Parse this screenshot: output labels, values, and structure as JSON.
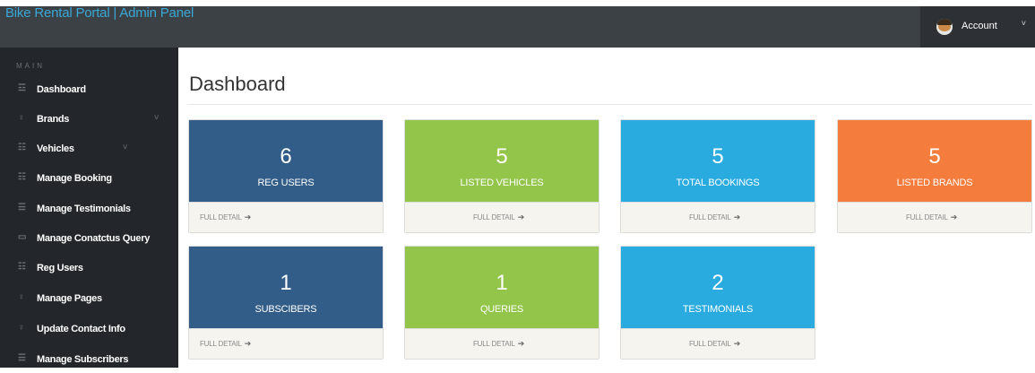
{
  "header": {
    "brand": "Bike Rental Portal | Admin Panel",
    "account_label": "Account",
    "account_chevron": "˅"
  },
  "sidebar": {
    "section_label": "MAIN",
    "items": [
      {
        "label": "Dashboard",
        "icon": "☲"
      },
      {
        "label": "Brands",
        "icon": "♀"
      },
      {
        "label": "Vehicles",
        "icon": "☷"
      },
      {
        "label": "Manage Booking",
        "icon": "☷"
      },
      {
        "label": "Manage Testimonials",
        "icon": "☰"
      },
      {
        "label": "Manage Conatctus Query",
        "icon": "▭"
      },
      {
        "label": "Reg Users",
        "icon": "☷"
      },
      {
        "label": "Manage Pages",
        "icon": "♀"
      },
      {
        "label": "Update Contact Info",
        "icon": "♀"
      },
      {
        "label": "Manage Subscribers",
        "icon": "☰"
      }
    ],
    "submenu_chevron": "˅"
  },
  "main": {
    "title": "Dashboard",
    "cards": [
      {
        "value": "6",
        "label": "REG USERS",
        "color": "#325d88",
        "detail": "FULL DETAIL",
        "arrow": "➔"
      },
      {
        "value": "5",
        "label": "LISTED VEHICLES",
        "color": "#93c54b",
        "detail": "FULL DETAIL",
        "arrow": "➔"
      },
      {
        "value": "5",
        "label": "TOTAL BOOKINGS",
        "color": "#29abe0",
        "detail": "FULL DETAIL",
        "arrow": "➔"
      },
      {
        "value": "5",
        "label": "LISTED BRANDS",
        "color": "#f47c3c",
        "detail": "FULL DETAIL",
        "arrow": "➔"
      },
      {
        "value": "1",
        "label": "SUBSCIBERS",
        "color": "#325d88",
        "detail": "FULL DETAIL",
        "arrow": "➔"
      },
      {
        "value": "1",
        "label": "QUERIES",
        "color": "#93c54b",
        "detail": "FULL DETAIL",
        "arrow": "➔"
      },
      {
        "value": "2",
        "label": "TESTIMONIALS",
        "color": "#29abe0",
        "detail": "FULL DETAIL",
        "arrow": "➔"
      }
    ]
  }
}
